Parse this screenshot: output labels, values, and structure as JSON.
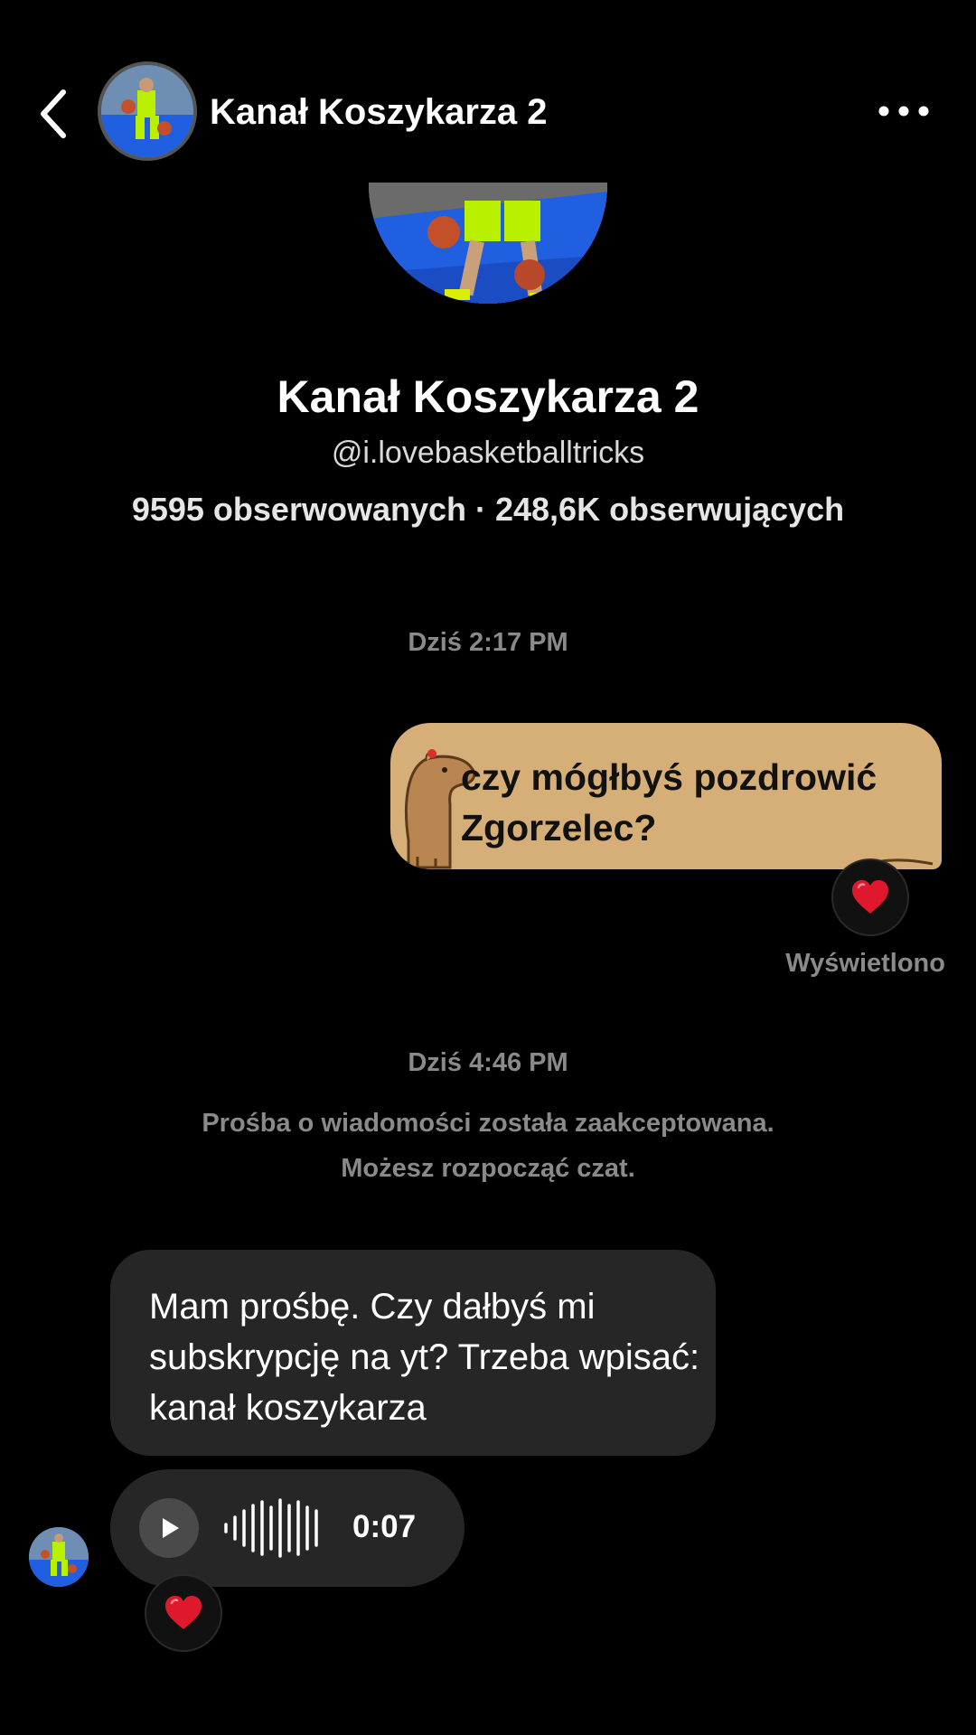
{
  "header": {
    "title": "Kanał Koszykarza 2",
    "back_icon": "chevron-left-icon",
    "more_icon": "more-horizontal-icon"
  },
  "profile": {
    "name": "Kanał Koszykarza 2",
    "handle": "@i.lovebasketballtricks",
    "stats": "9595 obserwowanych · 248,6K obserwujących"
  },
  "messages": {
    "timestamp_1": "Dziś 2:17 PM",
    "outgoing_text": "czy mógłbyś pozdrowić Zgorzelec?",
    "outgoing_reaction": "❤️",
    "seen_status": "Wyświetlono",
    "timestamp_2": "Dziś 4:46 PM",
    "system_line_1": "Prośba o wiadomości została zaakceptowana.",
    "system_line_2": "Możesz rozpocząć czat.",
    "incoming_text": "Mam prośbę. Czy dałbyś mi subskrypcję na yt? Trzeba wpisać: kanał koszykarza",
    "voice_duration": "0:07",
    "incoming_reaction": "❤️"
  },
  "colors": {
    "background": "#000000",
    "outgoing_bubble": "#d6ae77",
    "incoming_bubble": "#262626",
    "muted_text": "#8a8a8a",
    "reaction_heart": "#e0182b"
  }
}
